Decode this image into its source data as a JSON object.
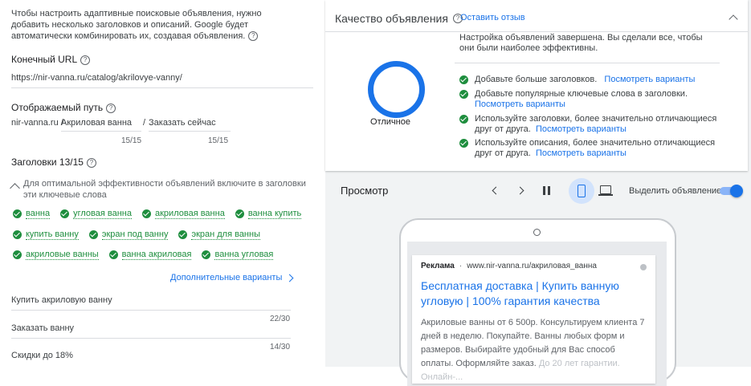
{
  "left": {
    "intro": "Чтобы настроить адаптивные поисковые объявления, нужно добавить несколько заголовков и описаний. Google будет автоматически комбинировать их, создавая объявления.",
    "final_url_label": "Конечный URL",
    "final_url_value": "https://nir-vanna.ru/catalog/akrilovye-vanny/",
    "display_path_label": "Отображаемый путь",
    "display_domain": "nir-vanna.ru /",
    "path1": "Акриловая ванна",
    "path_sep": "/",
    "path2": "Заказать сейчас",
    "path1_count": "15/15",
    "path2_count": "15/15",
    "headlines_label": "Заголовки 13/15",
    "headlines_tip": "Для оптимальной эффективности объявлений включите в заголовки эти ключевые слова",
    "keywords": [
      [
        "ванна",
        "угловая ванна",
        "акриловая ванна",
        "ванна купить"
      ],
      [
        "купить ванну",
        "экран под ванну",
        "экран для ванны"
      ],
      [
        "акриловые ванны",
        "ванна акриловая",
        "ванна угловая"
      ]
    ],
    "more_options": "Дополнительные варианты",
    "headline_inputs": [
      {
        "value": "Купить акриловую ванну",
        "count": "22/30"
      },
      {
        "value": "Заказать ванну",
        "count": "14/30"
      },
      {
        "value": "Скидки до 18%",
        "count": ""
      }
    ]
  },
  "quality": {
    "title": "Качество объявления",
    "feedback_link": "Оставить отзыв",
    "rating": "Отличное",
    "summary": "Настройка объявлений завершена. Вы сделали все, чтобы они были наиболее эффективны.",
    "items": [
      {
        "text": "Добавьте больше заголовков.",
        "link": "Посмотреть варианты"
      },
      {
        "text": "Добавьте популярные ключевые слова в заголовки.",
        "link": "Посмотреть варианты"
      },
      {
        "text": "Используйте заголовки, более значительно отличающиеся друг от друга.",
        "link": "Посмотреть варианты"
      },
      {
        "text": "Используйте описания, более значительно отличающиеся друг от друга.",
        "link": "Посмотреть варианты"
      }
    ],
    "colors": {
      "ring": "#1a73e8",
      "check": "#1e8e3e"
    }
  },
  "preview": {
    "title": "Просмотр",
    "highlight_label": "Выделить объявление",
    "highlight_on": true,
    "ad_badge": "Реклама",
    "ad_url": "www.nir-vanna.ru/акриловая_ванна",
    "ad_headline": "Бесплатная доставка | Купить ванную угловую | 100% гарантия качества",
    "ad_description": "Акриловые ванны от 6 500р. Консультируем клиента 7 дней в неделю. Покупайте. Ванны любых форм и размеров. Выбирайте удобный для Вас способ оплаты. Оформляйте заказ.",
    "ad_description_faded": "До 20 лет гарантии. Онлайн-..."
  }
}
